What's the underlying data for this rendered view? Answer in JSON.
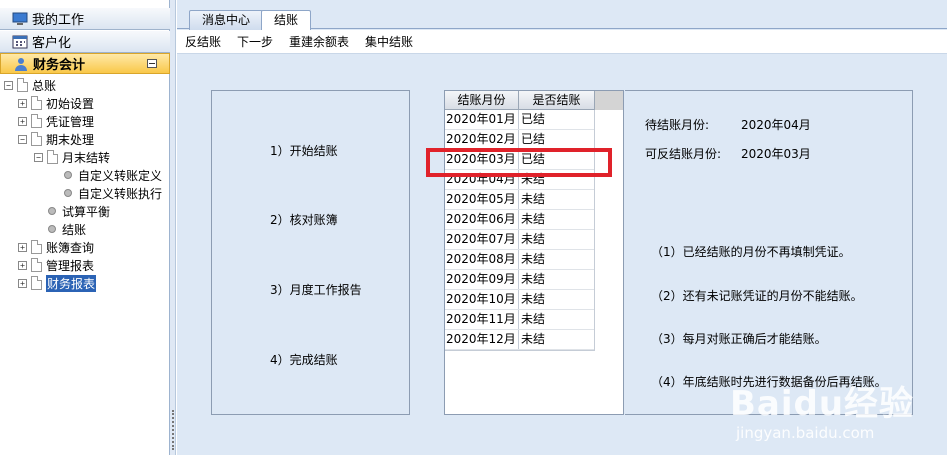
{
  "nav": {
    "work": "我的工作",
    "customize": "客户化",
    "finance": "财务会计"
  },
  "tree": {
    "root": "总账",
    "items": [
      {
        "label": "初始设置"
      },
      {
        "label": "凭证管理"
      },
      {
        "label": "期末处理"
      },
      {
        "label": "月末结转"
      },
      {
        "label": "自定义转账定义"
      },
      {
        "label": "自定义转账执行"
      },
      {
        "label": "试算平衡"
      },
      {
        "label": "结账"
      },
      {
        "label": "账簿查询"
      },
      {
        "label": "管理报表"
      },
      {
        "label": "财务报表"
      }
    ]
  },
  "tabs": {
    "message_center": "消息中心",
    "close_account": "结账"
  },
  "toolbar": {
    "reverse": "反结账",
    "next": "下一步",
    "rebuild": "重建余额表",
    "centralized": "集中结账"
  },
  "steps": [
    "1）开始结账",
    "2）核对账簿",
    "3）月度工作报告",
    "4）完成结账"
  ],
  "grid": {
    "headers": [
      "结账月份",
      "是否结账"
    ],
    "rows": [
      [
        "2020年01月",
        "已结"
      ],
      [
        "2020年02月",
        "已结"
      ],
      [
        "2020年03月",
        "已结"
      ],
      [
        "2020年04月",
        "未结"
      ],
      [
        "2020年05月",
        "未结"
      ],
      [
        "2020年06月",
        "未结"
      ],
      [
        "2020年07月",
        "未结"
      ],
      [
        "2020年08月",
        "未结"
      ],
      [
        "2020年09月",
        "未结"
      ],
      [
        "2020年10月",
        "未结"
      ],
      [
        "2020年11月",
        "未结"
      ],
      [
        "2020年12月",
        "未结"
      ]
    ]
  },
  "info": {
    "pending_label": "待结账月份:",
    "pending_value": "2020年04月",
    "reversible_label": "可反结账月份:",
    "reversible_value": "2020年03月",
    "notes": [
      "（1）已经结账的月份不再填制凭证。",
      "（2）还有未记账凭证的月份不能结账。",
      "（3）每月对账正确后才能结账。",
      "（4）年底结账时先进行数据备份后再结账。"
    ]
  },
  "watermark": {
    "brand": "Baidu经验",
    "url": "jingyan.baidu.com"
  },
  "colors": {
    "highlight": "#e0222a",
    "selected": "#2b63b5",
    "panel_bg": "#dde8f5"
  }
}
